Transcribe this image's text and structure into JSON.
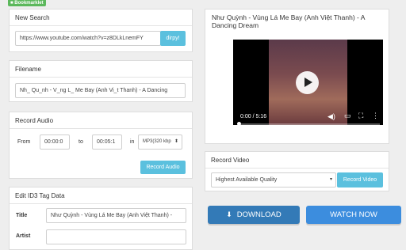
{
  "bookmarklet": {
    "label": "Bookmarklet"
  },
  "new_search": {
    "title": "New Search",
    "url_value": "https://www.youtube.com/watch?v=z8DLkLnemFY",
    "go_label": "dirpy!"
  },
  "filename": {
    "title": "Filename",
    "value": "Nh_ Qu_nh - V_ng L_ Me Bay (Anh Vi_t Thanh) - A Dancing"
  },
  "record_audio": {
    "title": "Record Audio",
    "from_label": "From",
    "from_value": "00:00:0",
    "to_label": "to",
    "to_value": "00:05:1",
    "in_label": "in",
    "format_value": "MP3(320 kbp",
    "button_label": "Record Audio"
  },
  "id3": {
    "title": "Edit ID3 Tag Data",
    "title_label": "Title",
    "title_value": "Như Quỳnh - Vùng Lá Me Bay (Anh Việt Thanh) -",
    "artist_label": "Artist",
    "artist_value": ""
  },
  "video": {
    "title": "Như Quỳnh - Vùng Lá Me Bay (Anh Việt Thanh) - A Dancing Dream",
    "time": "0:00 / 5:16",
    "progress": 0
  },
  "record_video": {
    "title": "Record Video",
    "quality_value": "Highest Available Quality",
    "button_label": "Record Video"
  },
  "download": {
    "label": "DOWNLOAD"
  },
  "watch_now": {
    "label": "WATCH NOW"
  },
  "colors": {
    "info": "#5bc0de",
    "primary": "#337ab7",
    "success": "#5cb85c"
  }
}
